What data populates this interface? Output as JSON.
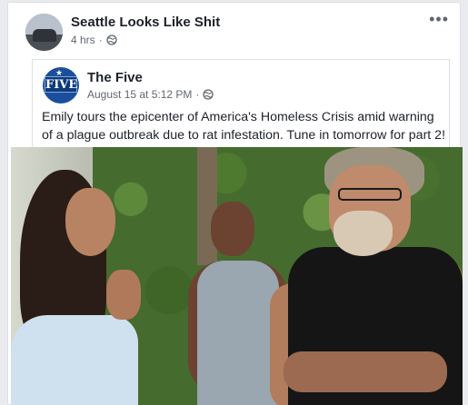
{
  "post": {
    "page_name": "Seattle Looks Like Shit",
    "time": "4 hrs",
    "separator": "·",
    "more_icon": "more-horizontal-icon"
  },
  "shared": {
    "page_name": "The Five",
    "date": "August 15 at 5:12 PM",
    "separator": "·",
    "logo_text": "FIVE",
    "caption": "Emily tours the epicenter of America's Homeless Crisis amid warning of a plague outbreak due to rat infestation. Tune in tomorrow for part 2!"
  },
  "colors": {
    "name": "#1d2129",
    "meta": "#606770",
    "border": "#dddfe2",
    "background": "#e9ebee"
  }
}
